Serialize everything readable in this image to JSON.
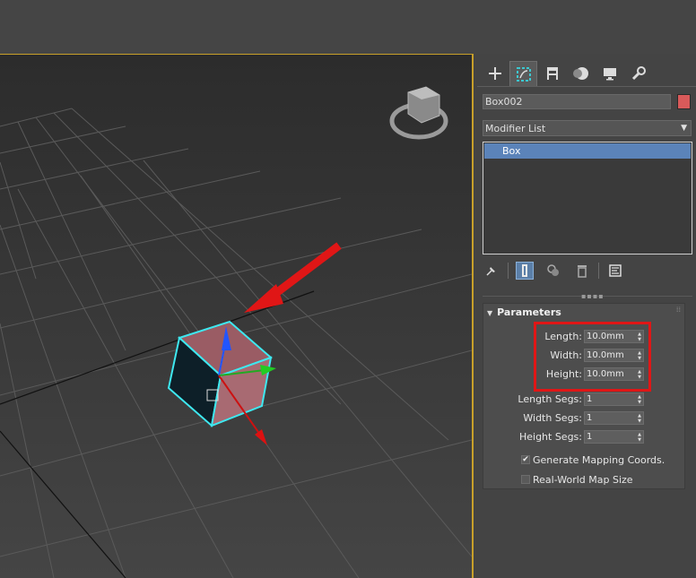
{
  "command_panel": {
    "tabs": [
      {
        "name": "create",
        "icon": "plus-icon"
      },
      {
        "name": "modify",
        "icon": "modify-icon",
        "active": true
      },
      {
        "name": "hierarchy",
        "icon": "hierarchy-icon"
      },
      {
        "name": "motion",
        "icon": "motion-icon"
      },
      {
        "name": "display",
        "icon": "display-icon"
      },
      {
        "name": "utilities",
        "icon": "wrench-icon"
      }
    ],
    "object_name": "Box002",
    "object_color": "#d95a5a",
    "modifier_list_label": "Modifier List",
    "stack_items": [
      "Box"
    ],
    "stack_toolbar": [
      "pin-icon",
      "show-end-result-icon",
      "make-unique-icon",
      "remove-modifier-icon",
      "configure-sets-icon"
    ]
  },
  "parameters": {
    "title": "Parameters",
    "length_label": "Length:",
    "length_value": "10.0mm",
    "width_label": "Width:",
    "width_value": "10.0mm",
    "height_label": "Height:",
    "height_value": "10.0mm",
    "length_segs_label": "Length Segs:",
    "length_segs_value": "1",
    "width_segs_label": "Width Segs:",
    "width_segs_value": "1",
    "height_segs_label": "Height Segs:",
    "height_segs_value": "1",
    "generate_mapping_label": "Generate Mapping Coords.",
    "generate_mapping_checked": true,
    "real_world_label": "Real-World Map Size",
    "real_world_checked": false
  },
  "annotations": {
    "highlight_color": "#e01616"
  }
}
